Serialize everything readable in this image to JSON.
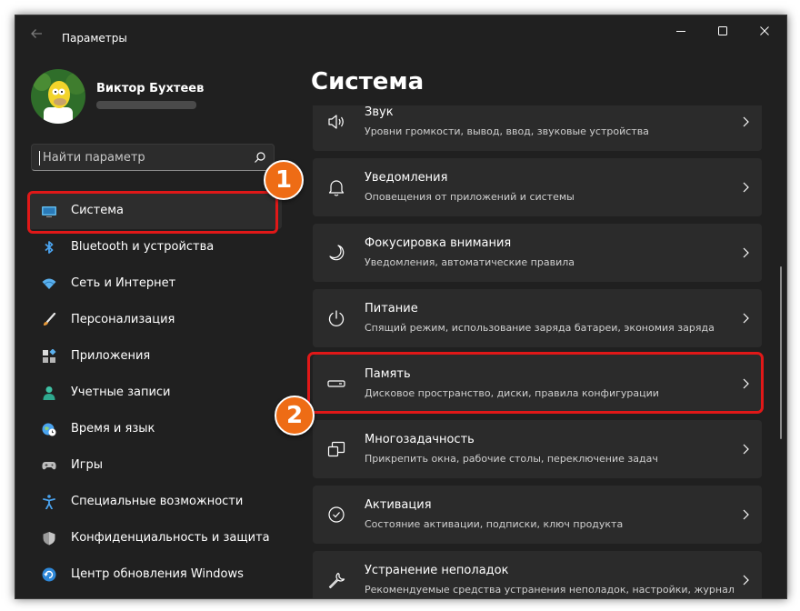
{
  "window": {
    "title": "Параметры"
  },
  "profile": {
    "name": "Виктор Бухтеев"
  },
  "search": {
    "placeholder": "Найти параметр"
  },
  "nav": [
    {
      "label": "Система",
      "icon": "monitor-icon",
      "selected": true
    },
    {
      "label": "Bluetooth и устройства",
      "icon": "bluetooth-icon"
    },
    {
      "label": "Сеть и Интернет",
      "icon": "wifi-icon"
    },
    {
      "label": "Персонализация",
      "icon": "brush-icon"
    },
    {
      "label": "Приложения",
      "icon": "apps-icon"
    },
    {
      "label": "Учетные записи",
      "icon": "user-icon"
    },
    {
      "label": "Время и язык",
      "icon": "globe-clock-icon"
    },
    {
      "label": "Игры",
      "icon": "gamepad-icon"
    },
    {
      "label": "Специальные возможности",
      "icon": "accessibility-icon"
    },
    {
      "label": "Конфиденциальность и защита",
      "icon": "shield-icon"
    },
    {
      "label": "Центр обновления Windows",
      "icon": "update-icon"
    }
  ],
  "page": {
    "title": "Система"
  },
  "cards": [
    {
      "title": "Звук",
      "subtitle": "Уровни громкости, вывод, ввод, звуковые устройства",
      "icon": "speaker-icon"
    },
    {
      "title": "Уведомления",
      "subtitle": "Оповещения от приложений и системы",
      "icon": "bell-icon"
    },
    {
      "title": "Фокусировка внимания",
      "subtitle": "Уведомления, автоматические правила",
      "icon": "moon-icon"
    },
    {
      "title": "Питание",
      "subtitle": "Спящий режим, использование заряда батареи, экономия заряда",
      "icon": "power-icon"
    },
    {
      "title": "Память",
      "subtitle": "Дисковое пространство, диски, правила конфигурации",
      "icon": "storage-icon"
    },
    {
      "title": "Многозадачность",
      "subtitle": "Прикрепить окна, рабочие столы, переключение задач",
      "icon": "multitask-icon"
    },
    {
      "title": "Активация",
      "subtitle": "Состояние активации, подписки, ключ продукта",
      "icon": "check-circle-icon"
    },
    {
      "title": "Устранение неполадок",
      "subtitle": "Рекомендуемые средства устранения неполадок, настройки, журнал",
      "icon": "wrench-icon"
    }
  ],
  "annotations": {
    "badge1": "1",
    "badge2": "2"
  },
  "colors": {
    "accent": "#60cdff",
    "highlight": "#e01818",
    "badge": "#ee6c15",
    "window_bg": "#202020",
    "card_bg": "#2b2b2b"
  }
}
